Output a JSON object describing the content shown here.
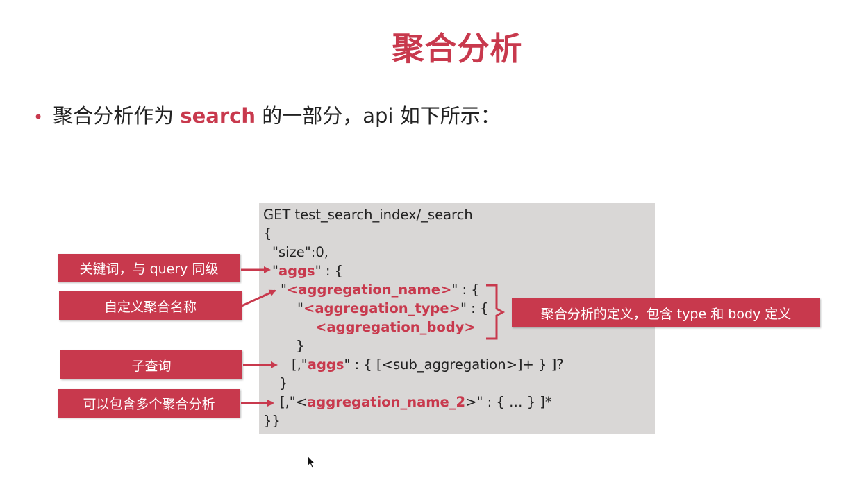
{
  "slide": {
    "title": "聚合分析",
    "bullet": {
      "before": "聚合分析作为 ",
      "highlight": "search",
      "after": " 的一部分，api 如下所示："
    }
  },
  "code": {
    "line1": "GET test_search_index/_search",
    "line2": "{",
    "line3": "\"size\":0,",
    "line4_pre": "\"",
    "line4_kw": "aggs",
    "line4_post": "\" : {",
    "line5_pre": "\"",
    "line5_kw": "<aggregation_name>",
    "line5_post": "\" : {",
    "line6_pre": "\"",
    "line6_kw": "<aggregation_type>",
    "line6_post": "\" : {",
    "line7_kw": "<aggregation_body>",
    "line8": "}",
    "line9_pre": "[,\"",
    "line9_kw": "aggs",
    "line9_post": "\" : { [<sub_aggregation>]+ } ]?",
    "line10": "}",
    "line11_pre": "[,\"<",
    "line11_kw": "aggregation_name_2",
    "line11_post": ">\" : { … } ]*",
    "line12": "}}"
  },
  "labels": {
    "keyword": "关键词，与 query 同级",
    "custom_name": "自定义聚合名称",
    "sub_query": "子查询",
    "multiple": "可以包含多个聚合分析",
    "definition": "聚合分析的定义，包含 type 和 body 定义"
  },
  "colors": {
    "accent": "#c8394d",
    "code_background": "#d9d7d6"
  }
}
